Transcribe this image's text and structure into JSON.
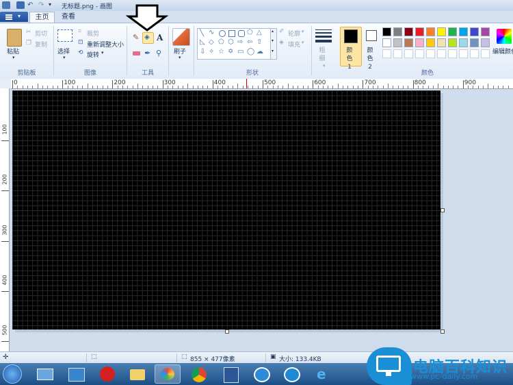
{
  "window": {
    "title": "无标题.png - 画图"
  },
  "tabs": [
    {
      "label": "主页",
      "active": true
    },
    {
      "label": "查看",
      "active": false
    }
  ],
  "clipboard": {
    "paste": "粘贴",
    "cut": "剪切",
    "copy": "复制",
    "group": "剪贴板"
  },
  "image": {
    "select": "选择",
    "crop": "裁剪",
    "resize": "重新调整大小",
    "rotate": "旋转",
    "group": "图像"
  },
  "tools": {
    "group": "工具",
    "text_glyph": "A"
  },
  "brushes": {
    "label": "刷子"
  },
  "shapes": {
    "outline": "轮廓",
    "fill": "填充",
    "group": "形状"
  },
  "size": {
    "label": "粗细"
  },
  "colors": {
    "color1": "颜色 1",
    "color2": "颜色 2",
    "group": "颜色",
    "edit": "编辑颜色",
    "color1_value": "#000000",
    "color2_value": "#ffffff",
    "palette_row1": [
      "#000000",
      "#7f7f7f",
      "#880015",
      "#ed1c24",
      "#ff7f27",
      "#fff200",
      "#22b14c",
      "#00a2e8",
      "#3f48cc",
      "#a349a4"
    ],
    "palette_row2": [
      "#ffffff",
      "#c3c3c3",
      "#b97a57",
      "#ffaec9",
      "#ffc90e",
      "#efe4b0",
      "#b5e61d",
      "#99d9ea",
      "#7092be",
      "#c8bfe7"
    ]
  },
  "ruler": {
    "h": [
      "0",
      "100",
      "200",
      "300",
      "400",
      "500",
      "600",
      "700",
      "800",
      "900"
    ],
    "v": [
      "100",
      "200",
      "300",
      "400",
      "500"
    ]
  },
  "status": {
    "dimensions": "855 × 477像素",
    "filesize": "大小: 133.4KB"
  },
  "watermark": {
    "title": "电脑百科知识",
    "url": "www.pc-daily.com"
  }
}
